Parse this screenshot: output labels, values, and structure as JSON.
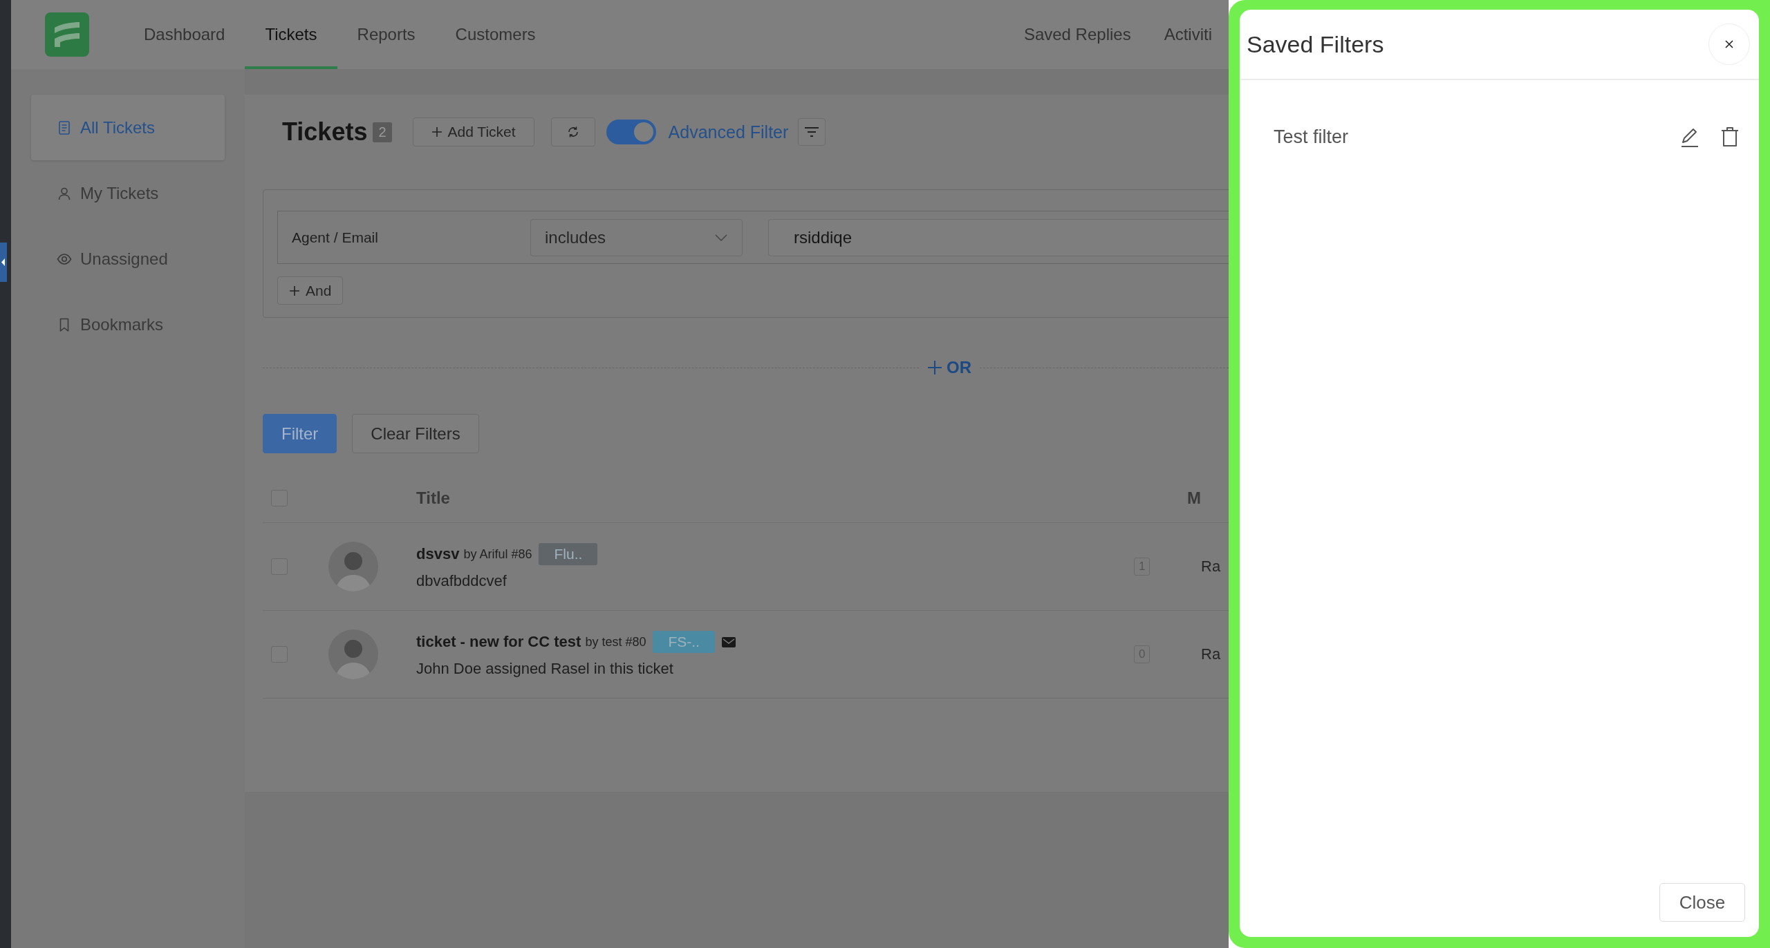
{
  "nav": {
    "items": [
      {
        "label": "Dashboard",
        "selected": false
      },
      {
        "label": "Tickets",
        "selected": true
      },
      {
        "label": "Reports",
        "selected": false
      },
      {
        "label": "Customers",
        "selected": false
      }
    ],
    "right_items": [
      "Saved Replies",
      "Activiti"
    ]
  },
  "sidebar": {
    "items": [
      {
        "label": "All Tickets",
        "selected": true
      },
      {
        "label": "My Tickets",
        "selected": false
      },
      {
        "label": "Unassigned",
        "selected": false
      },
      {
        "label": "Bookmarks",
        "selected": false
      }
    ]
  },
  "tickets": {
    "title": "Tickets",
    "count": "2",
    "add_button": "Add Ticket",
    "advanced_filter": {
      "label": "Advanced Filter",
      "on": true
    }
  },
  "filter": {
    "groups": [
      {
        "conditions": [
          {
            "field": "Agent / Email",
            "operator": "includes",
            "value": "rsiddiqe"
          }
        ],
        "and_button": "And"
      }
    ],
    "or_button": "OR",
    "buttons": [
      "Filter",
      "Clear Filters"
    ]
  },
  "table": {
    "header_checked": false,
    "columns": [
      "Title",
      "M"
    ],
    "rows": [
      {
        "checked": false,
        "title": "dsvsv",
        "byline": "by Ariful #86",
        "tag": {
          "label": "Flu..",
          "color": "#5f6569"
        },
        "email": false,
        "excerpt": "dbvafbddcvef",
        "count": "1",
        "column_3": "Ra"
      },
      {
        "checked": false,
        "title": "ticket - new for CC test",
        "byline": "by test #80",
        "tag": {
          "label": "FS-..",
          "color": "#4a8aa3"
        },
        "email": true,
        "excerpt": "John Doe assigned Rasel in this ticket",
        "count": "0",
        "column_3": "Ra"
      }
    ]
  },
  "drawer": {
    "title": "Saved Filters",
    "filters": [
      {
        "name": "Test filter"
      }
    ],
    "close_button": "Close"
  }
}
